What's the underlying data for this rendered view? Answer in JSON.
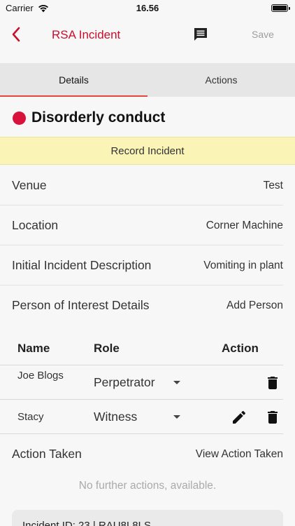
{
  "status_bar": {
    "carrier": "Carrier",
    "time": "16.56"
  },
  "nav": {
    "title": "RSA Incident",
    "save_label": "Save"
  },
  "tabs": [
    {
      "label": "Details",
      "active": true
    },
    {
      "label": "Actions",
      "active": false
    }
  ],
  "incident": {
    "title": "Disorderly conduct",
    "status_color": "#d8123b"
  },
  "record_banner": "Record Incident",
  "rows": [
    {
      "label": "Venue",
      "value": "Test"
    },
    {
      "label": "Location",
      "value": "Corner Machine"
    },
    {
      "label": "Initial Incident Description",
      "value": "Vomiting in plant"
    },
    {
      "label": "Person of Interest Details",
      "value": "Add Person"
    }
  ],
  "people_table": {
    "headers": [
      "Name",
      "Role",
      "Action"
    ],
    "rows": [
      {
        "name": "Joe Blogs",
        "role": "Perpetrator"
      },
      {
        "name": "Stacy",
        "role": "Witness"
      }
    ]
  },
  "action_taken": {
    "label": "Action Taken",
    "value": "View Action Taken"
  },
  "no_further_actions": "No further actions, available.",
  "bottom_card": "Incident ID: 23 | RAU8L8LS"
}
